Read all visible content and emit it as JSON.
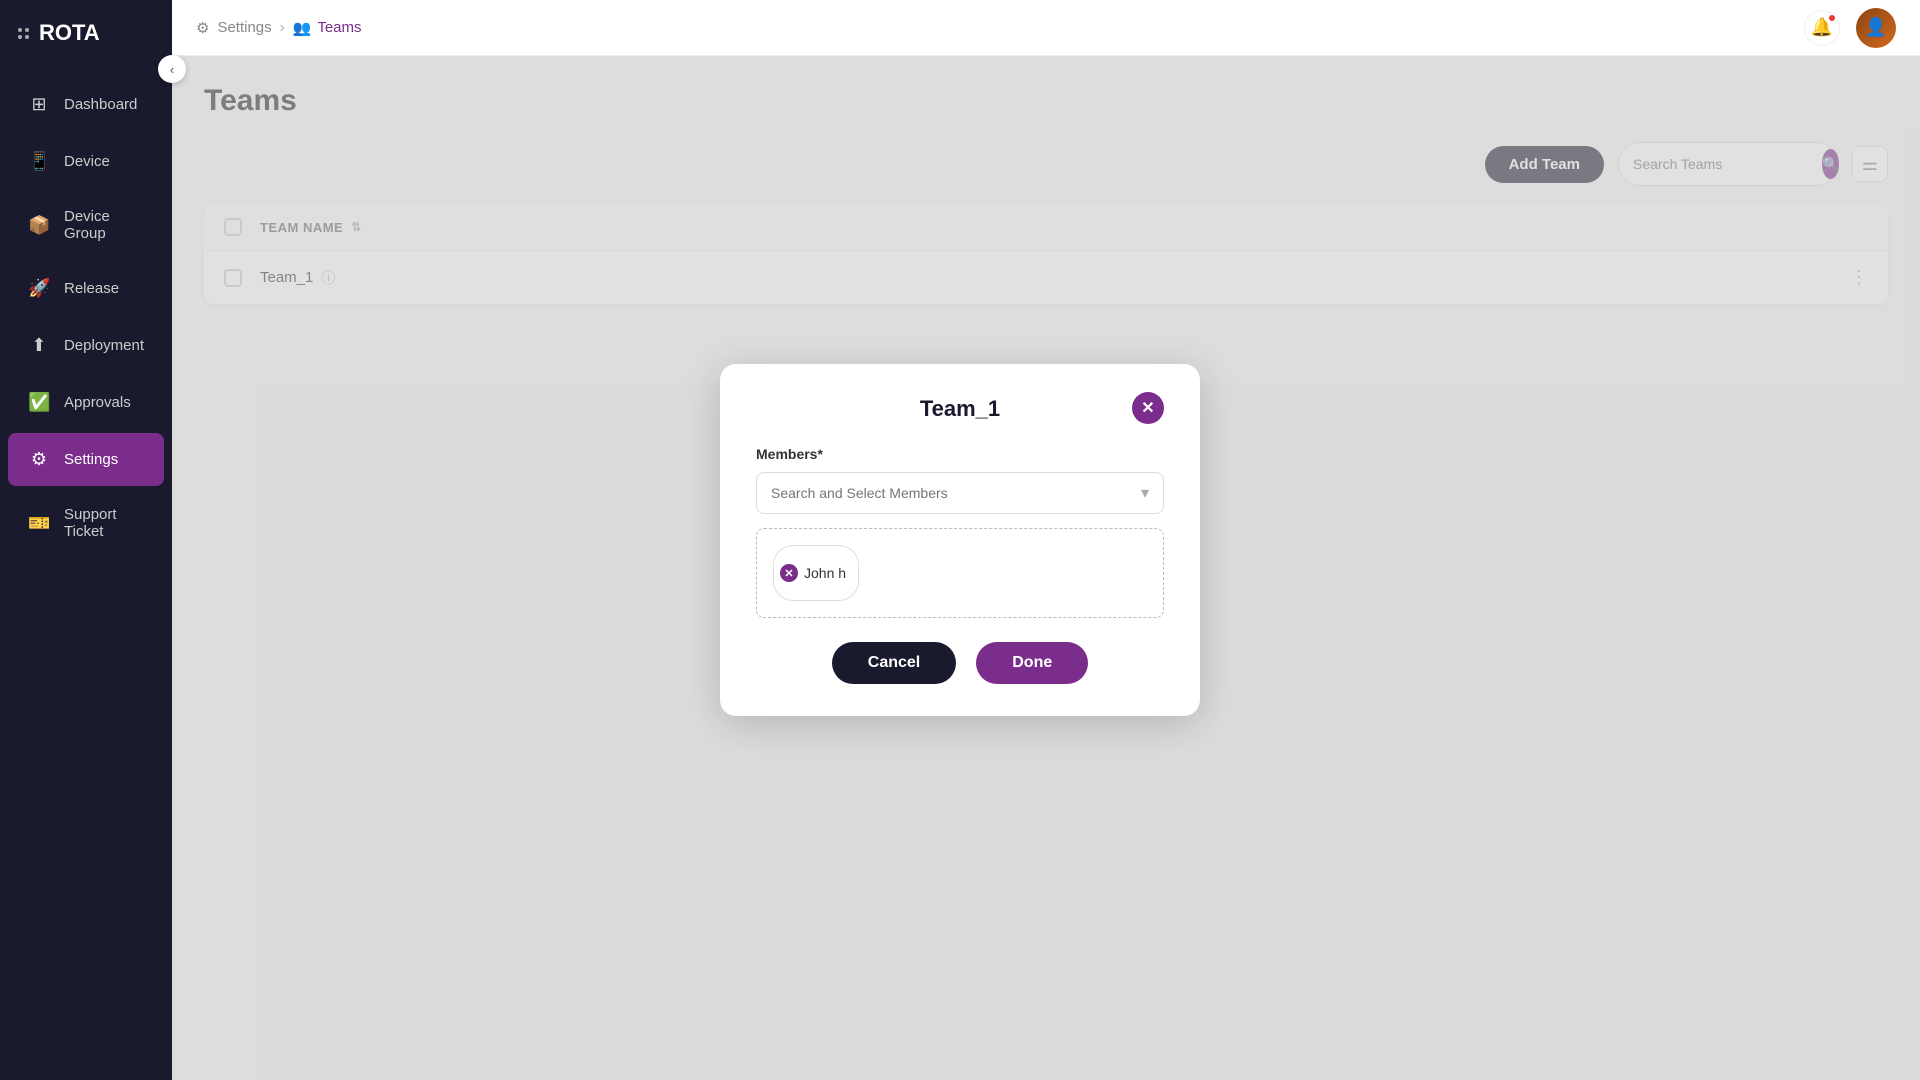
{
  "app": {
    "name": "ROTA"
  },
  "sidebar": {
    "items": [
      {
        "id": "dashboard",
        "label": "Dashboard",
        "icon": "⊞"
      },
      {
        "id": "device",
        "label": "Device",
        "icon": "📱"
      },
      {
        "id": "device-group",
        "label": "Device Group",
        "icon": "📦"
      },
      {
        "id": "release",
        "label": "Release",
        "icon": "🚀"
      },
      {
        "id": "deployment",
        "label": "Deployment",
        "icon": "⬆"
      },
      {
        "id": "approvals",
        "label": "Approvals",
        "icon": "✅"
      },
      {
        "id": "settings",
        "label": "Settings",
        "icon": "⚙"
      },
      {
        "id": "support-ticket",
        "label": "Support Ticket",
        "icon": "🎫"
      }
    ],
    "active": "settings"
  },
  "breadcrumb": {
    "parent": "Settings",
    "current": "Teams"
  },
  "page": {
    "title": "Teams"
  },
  "toolbar": {
    "add_team_label": "Add Team",
    "search_placeholder": "Search Teams",
    "search_label": "Search Teams"
  },
  "table": {
    "columns": [
      {
        "id": "name",
        "label": "TEAM NAME"
      }
    ],
    "rows": [
      {
        "id": 1,
        "name": "Team_1"
      }
    ]
  },
  "modal": {
    "title": "Team_1",
    "members_label": "Members*",
    "search_placeholder": "Search and Select Members",
    "selected_members": [
      {
        "id": 1,
        "name": "John h"
      }
    ],
    "cancel_label": "Cancel",
    "done_label": "Done"
  }
}
